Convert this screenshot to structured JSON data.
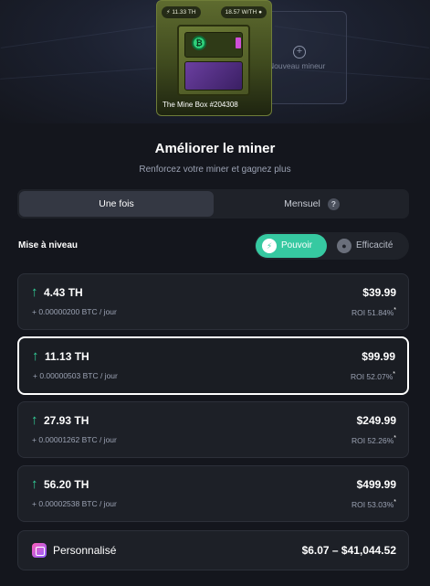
{
  "hero": {
    "miner_name": "The Mine Box #204308",
    "hashrate_chip": "11.33 TH",
    "efficiency_chip": "18.57 W/TH",
    "new_miner_label": "Nouveau mineur"
  },
  "header": {
    "title": "Améliorer le miner",
    "subtitle": "Renforcez votre miner et gagnez plus"
  },
  "tabs": [
    {
      "label": "Une fois",
      "active": true
    },
    {
      "label": "Mensuel",
      "active": false
    }
  ],
  "upgrade": {
    "section_label": "Mise à niveau",
    "modes": [
      {
        "label": "Pouvoir",
        "icon": "lightning-icon",
        "active": true
      },
      {
        "label": "Efficacité",
        "icon": "energy-icon",
        "active": false
      }
    ]
  },
  "plans": [
    {
      "hashrate": "4.43 TH",
      "btc": "+ 0.00000200 BTC / jour",
      "price": "$39.99",
      "roi": "ROI 51.84%",
      "selected": false
    },
    {
      "hashrate": "11.13 TH",
      "btc": "+ 0.00000503 BTC / jour",
      "price": "$99.99",
      "roi": "ROI 52.07%",
      "selected": true
    },
    {
      "hashrate": "27.93 TH",
      "btc": "+ 0.00001262 BTC / jour",
      "price": "$249.99",
      "roi": "ROI 52.26%",
      "selected": false
    },
    {
      "hashrate": "56.20 TH",
      "btc": "+ 0.00002538 BTC / jour",
      "price": "$499.99",
      "roi": "ROI 53.03%",
      "selected": false
    }
  ],
  "roi_footnote_mark": "*",
  "custom": {
    "label": "Personnalisé",
    "range": "$6.07 – $41,044.52"
  },
  "colors": {
    "background": "#14161d",
    "accent": "#36c9a1",
    "arrow_up": "#33d29a",
    "card": "#1d2027"
  }
}
